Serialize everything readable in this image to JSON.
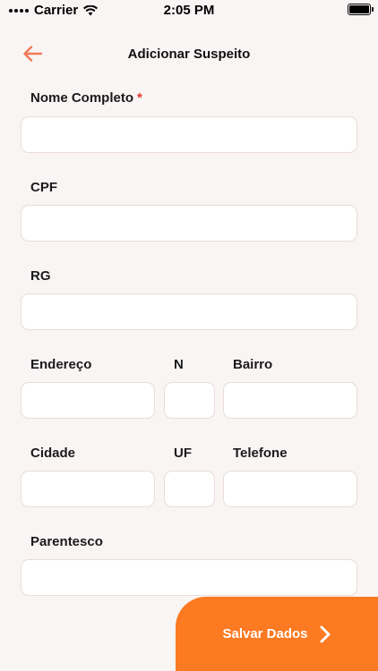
{
  "status_bar": {
    "carrier": "Carrier",
    "time": "2:05 PM"
  },
  "header": {
    "title": "Adicionar Suspeito",
    "back_icon": "arrow-left-icon"
  },
  "form": {
    "nome": {
      "label": "Nome Completo",
      "required_marker": "*",
      "value": ""
    },
    "cpf": {
      "label": "CPF",
      "value": ""
    },
    "rg": {
      "label": "RG",
      "value": ""
    },
    "endereco": {
      "label": "Endereço",
      "value": ""
    },
    "numero": {
      "label": "N",
      "value": ""
    },
    "bairro": {
      "label": "Bairro",
      "value": ""
    },
    "cidade": {
      "label": "Cidade",
      "value": ""
    },
    "uf": {
      "label": "UF",
      "value": ""
    },
    "telefone": {
      "label": "Telefone",
      "value": ""
    },
    "parentesco": {
      "label": "Parentesco",
      "value": ""
    }
  },
  "actions": {
    "save_label": "Salvar Dados",
    "save_icon": "chevron-right-icon"
  },
  "colors": {
    "accent": "#fb7a22",
    "back_arrow": "#f07a5a",
    "required": "#e23b2e",
    "background": "#f9f5f4"
  }
}
